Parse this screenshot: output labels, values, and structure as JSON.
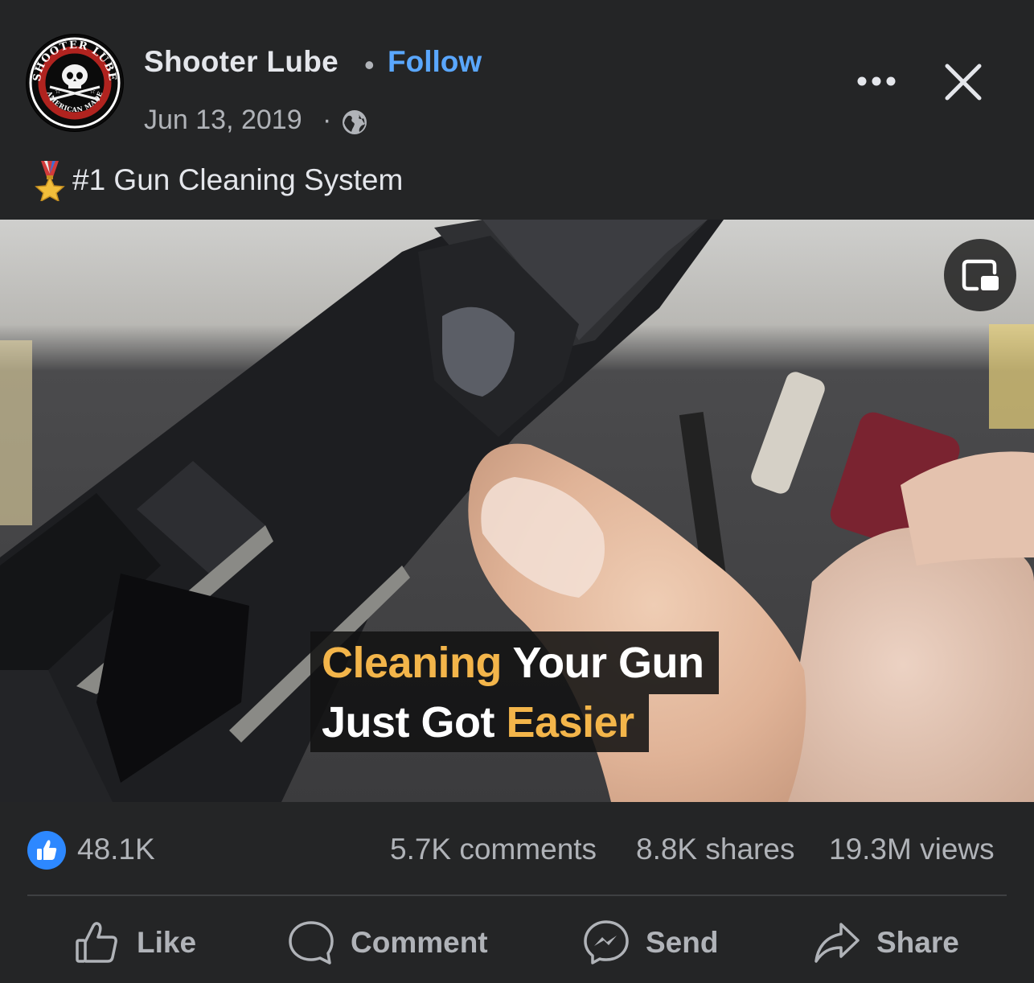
{
  "post": {
    "page_name": "Shooter Lube",
    "separator": "•",
    "follow_label": "Follow",
    "date": "Jun 13, 2019",
    "date_separator": "·",
    "audience_icon": "globe-icon",
    "caption": "#1 Gun Cleaning System",
    "caption_emoji": "military-medal-icon",
    "avatar_text": {
      "top": "SHOOTER LUBE",
      "bottom": "AMERICAN MADE"
    }
  },
  "header_actions": {
    "more_icon": "more-horizontal-icon",
    "close_icon": "close-icon"
  },
  "video": {
    "pip_icon": "picture-in-picture-icon",
    "subtitle": {
      "line1_accent": "Cleaning",
      "line1_rest": " Your Gun",
      "line2_rest": "Just Got ",
      "line2_accent": "Easier"
    }
  },
  "stats": {
    "likes": "48.1K",
    "comments": "5.7K comments",
    "shares": "8.8K shares",
    "views": "19.3M views"
  },
  "actions": [
    {
      "label": "Like",
      "icon": "thumbs-up-icon"
    },
    {
      "label": "Comment",
      "icon": "comment-icon"
    },
    {
      "label": "Send",
      "icon": "messenger-icon"
    },
    {
      "label": "Share",
      "icon": "share-arrow-icon"
    }
  ],
  "colors": {
    "background": "#242526",
    "text_primary": "#e4e6eb",
    "text_secondary": "#b0b3b8",
    "link": "#5aa7ff",
    "like_blue": "#2d88ff",
    "subtitle_accent": "#f3b54a"
  }
}
